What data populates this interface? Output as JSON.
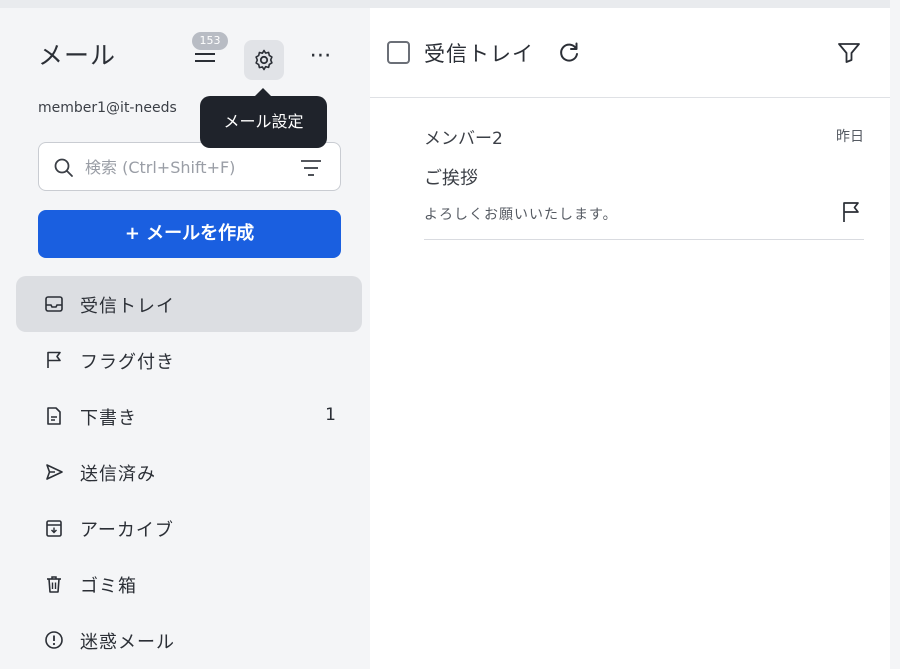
{
  "sidebar": {
    "title": "メール",
    "sort_badge": "153",
    "tooltip": "メール設定",
    "account_email": "member1@it-needs",
    "search_placeholder": "検索 (Ctrl+Shift+F)",
    "compose_label": "+ メールを作成",
    "items": [
      {
        "icon": "inbox-icon",
        "label": "受信トレイ",
        "count": "",
        "active": true
      },
      {
        "icon": "flag-icon",
        "label": "フラグ付き",
        "count": ""
      },
      {
        "icon": "draft-document-icon",
        "label": "下書き",
        "count": "1"
      },
      {
        "icon": "send-icon",
        "label": "送信済み",
        "count": ""
      },
      {
        "icon": "archive-icon",
        "label": "アーカイブ",
        "count": ""
      },
      {
        "icon": "trash-icon",
        "label": "ゴミ箱",
        "count": ""
      },
      {
        "icon": "spam-alert-icon",
        "label": "迷惑メール",
        "count": ""
      }
    ]
  },
  "main": {
    "folder_title": "受信トレイ",
    "messages": [
      {
        "from": "メンバー2",
        "date": "昨日",
        "subject": "ご挨拶",
        "preview": "よろしくお願いいたします。"
      }
    ]
  },
  "colors": {
    "accent": "#1a5fe0",
    "sidebar_bg": "#f4f5f7",
    "active_item_bg": "#dcdee2",
    "tooltip_bg": "#1f232b"
  }
}
